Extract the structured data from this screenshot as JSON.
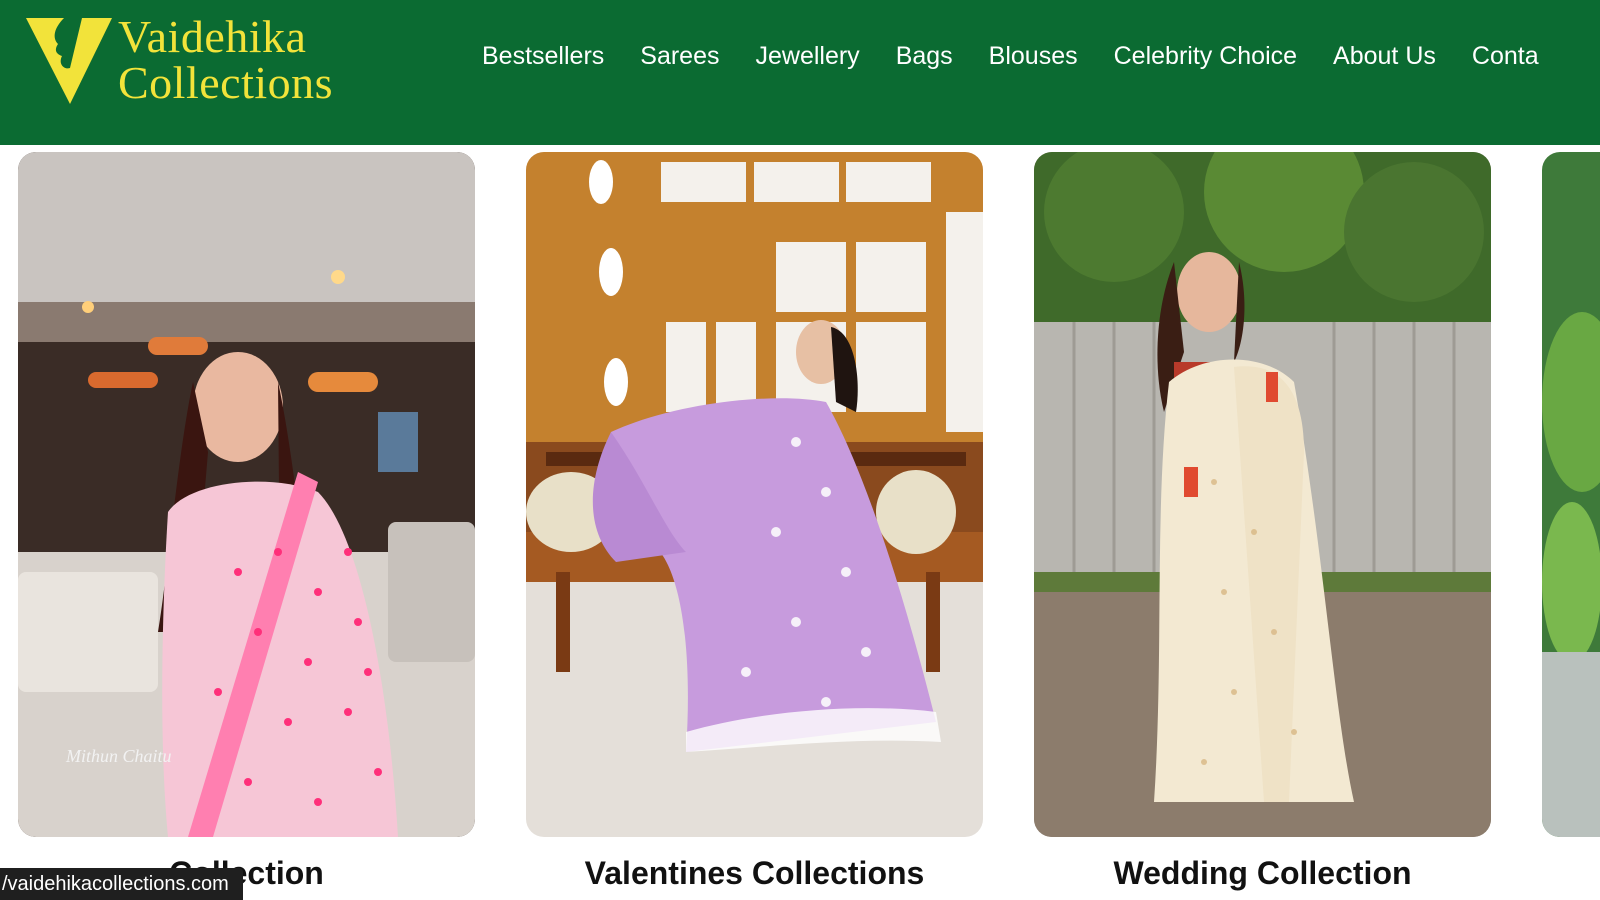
{
  "brand": {
    "line1": "Vaidehika",
    "line2": "Collections",
    "colors": {
      "header_bg": "#0b6b32",
      "logo": "#f2e33a"
    }
  },
  "nav": {
    "items": [
      "Bestsellers",
      "Sarees",
      "Jewellery",
      "Bags",
      "Blouses",
      "Celebrity Choice",
      "About Us",
      "Conta"
    ]
  },
  "collections": [
    {
      "caption": "Collection",
      "image": "woman-in-pink-saree-photo",
      "image_signature": "Mithun Chaitu"
    },
    {
      "caption": "Valentines Collections",
      "image": "woman-in-lavender-saree-photo"
    },
    {
      "caption": "Wedding Collection",
      "image": "woman-in-cream-saree-photo"
    },
    {
      "caption": "",
      "image": "partial-garden-photo"
    }
  ],
  "status_bar": {
    "url": "/vaidehikacollections.com"
  }
}
